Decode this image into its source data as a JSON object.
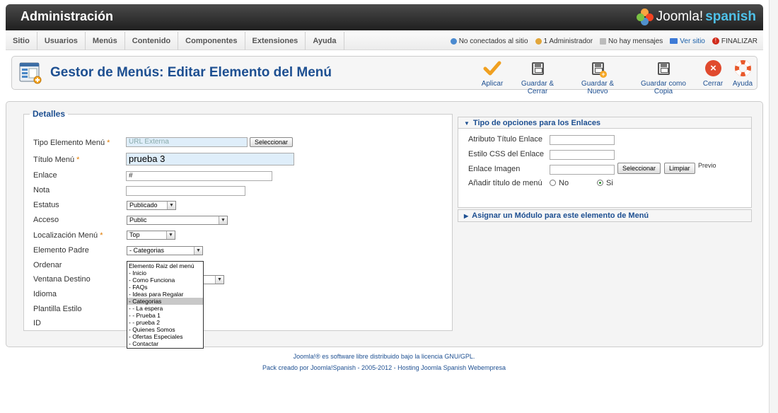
{
  "header": {
    "title": "Administración",
    "logo_word": "Joomla!",
    "logo_sub": "spanish"
  },
  "menu": [
    {
      "label": "Sitio"
    },
    {
      "label": "Usuarios"
    },
    {
      "label": "Menús"
    },
    {
      "label": "Contenido"
    },
    {
      "label": "Componentes"
    },
    {
      "label": "Extensiones"
    },
    {
      "label": "Ayuda"
    }
  ],
  "status": {
    "not_connected": "No conectados al sitio",
    "admins": "1 Administrador",
    "messages": "No hay mensajes",
    "view_site": "Ver sitio",
    "logout": "FINALIZAR"
  },
  "toolbar": {
    "page_title": "Gestor de Menús: Editar Elemento del Menú",
    "apply": "Aplicar",
    "save_close": "Guardar & Cerrar",
    "save_new": "Guardar & Nuevo",
    "save_copy": "Guardar como Copia",
    "close": "Cerrar",
    "help": "Ayuda"
  },
  "details": {
    "legend": "Detalles",
    "type_label": "Tipo Elemento Menú",
    "type_value": "URL Externa",
    "select_button": "Seleccionar",
    "title_label": "Título Menú",
    "title_value": "prueba 3",
    "link_label": "Enlace",
    "link_value": "#",
    "note_label": "Nota",
    "note_value": "",
    "status_label": "Estatus",
    "status_value": "Publicado",
    "access_label": "Acceso",
    "access_value": "Public",
    "location_label": "Localización Menú",
    "location_value": "Top",
    "parent_label": "Elemento Padre",
    "parent_value": "- Categorias",
    "order_label": "Ordenar",
    "target_label": "Ventana Destino",
    "language_label": "Idioma",
    "template_label": "Plantilla Estilo",
    "id_label": "ID",
    "required_mark": "*",
    "parent_options": [
      "Elemento Raiz del menú",
      "- Inicio",
      "- Como Funciona",
      "- FAQs",
      "- Ideas para Regalar",
      "- Categorias",
      "- - La espera",
      "- - Prueba 1",
      "- - prueba 2",
      "- Quienes Somos",
      "- Ofertas Especiales",
      "- Contactar"
    ],
    "parent_selected_index": 5
  },
  "link_options": {
    "title": "Tipo de opciones para los Enlaces",
    "title_attr_label": "Atributo Título Enlace",
    "css_label": "Estilo CSS del Enlace",
    "image_label": "Enlace Imagen",
    "image_select": "Seleccionar",
    "image_clear": "Limpiar",
    "preview": "Previo",
    "add_title_label": "Añadir título de menú",
    "no_label": "No",
    "yes_label": "Si"
  },
  "module_panel": {
    "title": "Asignar un Módulo para este elemento de Menú"
  },
  "footer": {
    "line1": "Joomla!® es software libre distribuido bajo la licencia GNU/GPL.",
    "line2": "Pack creado por Joomla!Spanish - 2005-2012 - Hosting Joomla Spanish Webempresa"
  }
}
